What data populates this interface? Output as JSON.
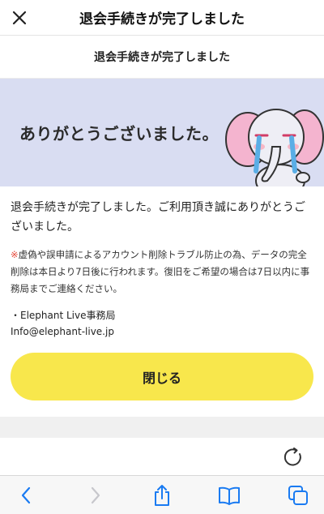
{
  "navbar": {
    "title": "退会手続きが完了しました",
    "close_icon": "close-icon"
  },
  "subheader": {
    "title": "退会手続きが完了しました"
  },
  "banner": {
    "text": "ありがとうございました。",
    "background": "#d9ddf2"
  },
  "content": {
    "message": "退会手続きが完了しました。ご利用頂き誠にありがとうございました。",
    "notice_mark": "※",
    "notice": "虚偽や誤申請によるアカウント削除トラブル防止の為、データの完全削除は本日より7日後に行われます。復旧をご希望の場合は7日以内に事務局までご連絡ください。",
    "sender_name": "・Elephant Live事務局",
    "sender_email": "Info@elephant-live.jp"
  },
  "button": {
    "label": "閉じる",
    "color": "#f8e74c"
  },
  "colors": {
    "notice_mark": "#e64a3b",
    "ios_blue": "#1a7bf2"
  },
  "toolbar": {
    "icons": [
      "back-icon",
      "forward-icon",
      "share-icon",
      "bookmarks-icon",
      "tabs-icon"
    ]
  }
}
